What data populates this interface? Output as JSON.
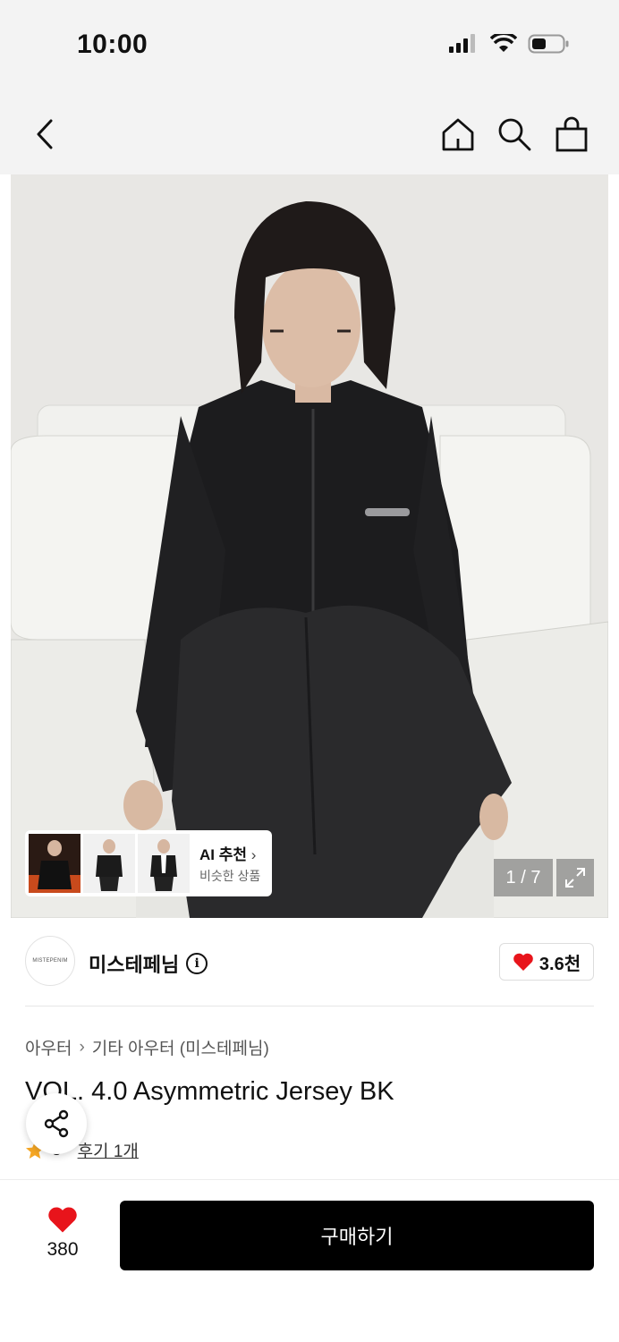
{
  "status_bar": {
    "time": "10:00"
  },
  "header": {
    "back_icon": "chevron-left-icon",
    "home_icon": "home-icon",
    "search_icon": "search-icon",
    "cart_icon": "shopping-bag-icon"
  },
  "gallery": {
    "counter": "1 / 7",
    "ai_recommend": {
      "title": "AI 추천",
      "subtitle": "비슷한 상품"
    }
  },
  "brand": {
    "name": "미스테페님",
    "logo_text": "MISTEPENIM",
    "likes": "3.6천"
  },
  "breadcrumb": [
    "아우터",
    "기타 아우터 (미스테페님)"
  ],
  "product": {
    "title": "VOL. 4.0 Asymmetric Jersey BK",
    "rating": "5",
    "review_link": "후기 1개"
  },
  "bottom_bar": {
    "like_count": "380",
    "buy_label": "구매하기"
  },
  "colors": {
    "accent": "#e8141b",
    "button": "#000000",
    "star": "#f5a623"
  }
}
